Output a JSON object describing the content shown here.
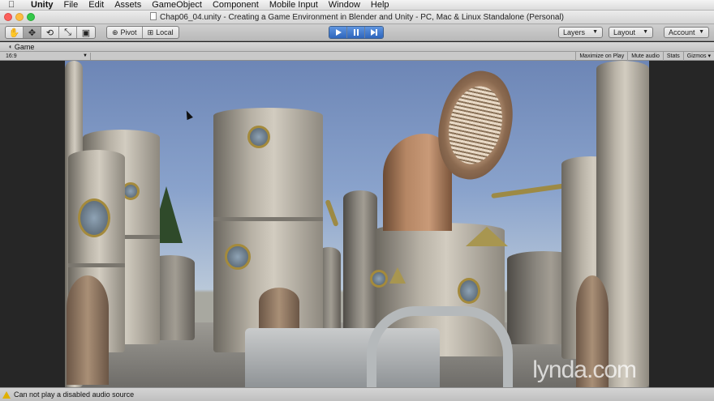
{
  "menubar": {
    "apple_icon": "apple-icon",
    "app_name": "Unity",
    "items": [
      "File",
      "Edit",
      "Assets",
      "GameObject",
      "Component",
      "Mobile Input",
      "Window",
      "Help"
    ]
  },
  "window": {
    "title": "Chap06_04.unity - Creating a Game Environment in Blender and Unity - PC, Mac & Linux Standalone (Personal)"
  },
  "toolbar": {
    "transform_tools": [
      {
        "name": "hand-tool",
        "glyph": "✋"
      },
      {
        "name": "move-tool",
        "glyph": "✥"
      },
      {
        "name": "rotate-tool",
        "glyph": "⟲"
      },
      {
        "name": "scale-tool",
        "glyph": "⤡"
      },
      {
        "name": "rect-tool",
        "glyph": "▣"
      }
    ],
    "pivot_label": "Pivot",
    "local_label": "Local",
    "playback": [
      "play",
      "pause",
      "step"
    ],
    "layers_label": "Layers",
    "layout_label": "Layout",
    "account_label": "Account"
  },
  "game_panel": {
    "tab_label": "Game",
    "aspect_label": "16:9",
    "buttons": [
      "Maximize on Play",
      "Mute audio",
      "Stats",
      "Gizmos"
    ]
  },
  "viewport": {
    "watermark": "lynda.com"
  },
  "status": {
    "message": "Can not play a disabled audio source"
  },
  "colors": {
    "play_active": "#2e66bd",
    "warning": "#e0b000"
  }
}
